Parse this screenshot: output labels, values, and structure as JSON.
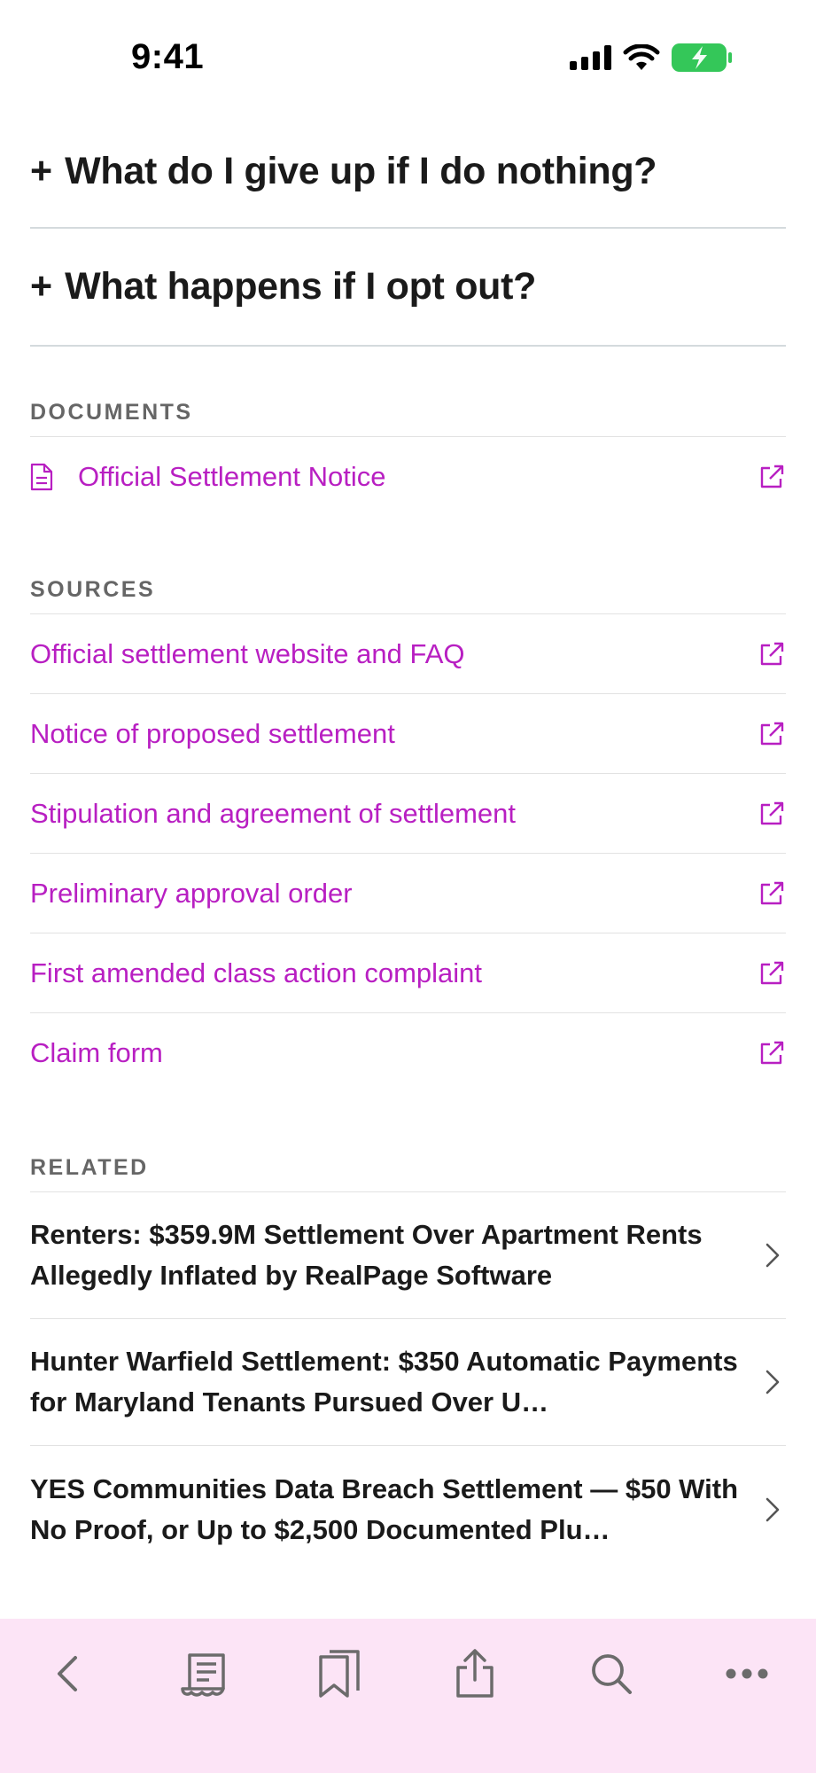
{
  "status_bar": {
    "time": "9:41",
    "icons": [
      "cellular-signal-icon",
      "wifi-icon",
      "battery-charging-icon"
    ],
    "battery_color": "#34c759"
  },
  "accordion": [
    {
      "label": "What do I give up if I do nothing?",
      "prefix": "+"
    },
    {
      "label": "What happens if I opt out?",
      "prefix": "+"
    }
  ],
  "documents": {
    "heading": "DOCUMENTS",
    "items": [
      {
        "label": "Official Settlement Notice",
        "icon": "document-icon"
      }
    ]
  },
  "sources": {
    "heading": "SOURCES",
    "items": [
      {
        "label": "Official settlement website and FAQ"
      },
      {
        "label": "Notice of proposed settlement"
      },
      {
        "label": "Stipulation and agreement of settlement"
      },
      {
        "label": "Preliminary approval order"
      },
      {
        "label": "First amended class action complaint"
      },
      {
        "label": "Claim form"
      }
    ]
  },
  "related": {
    "heading": "RELATED",
    "items": [
      {
        "title": "Renters: $359.9M Settlement Over Apartment Rents Allegedly Inflated by RealPage Software"
      },
      {
        "title": "Hunter Warfield Settlement: $350 Automatic Payments for Maryland Tenants Pursued Over U…"
      },
      {
        "title": "YES Communities Data Breach Settlement — $50 With No Proof, or Up to $2,500 Documented Plu…"
      }
    ]
  },
  "toolbar": {
    "buttons": [
      "back-icon",
      "receipt-icon",
      "bookmarks-icon",
      "share-icon",
      "search-icon",
      "more-icon"
    ]
  },
  "colors": {
    "link": "#b81fc2",
    "toolbar_bg": "#fce4f6",
    "divider": "#d4dadd"
  }
}
